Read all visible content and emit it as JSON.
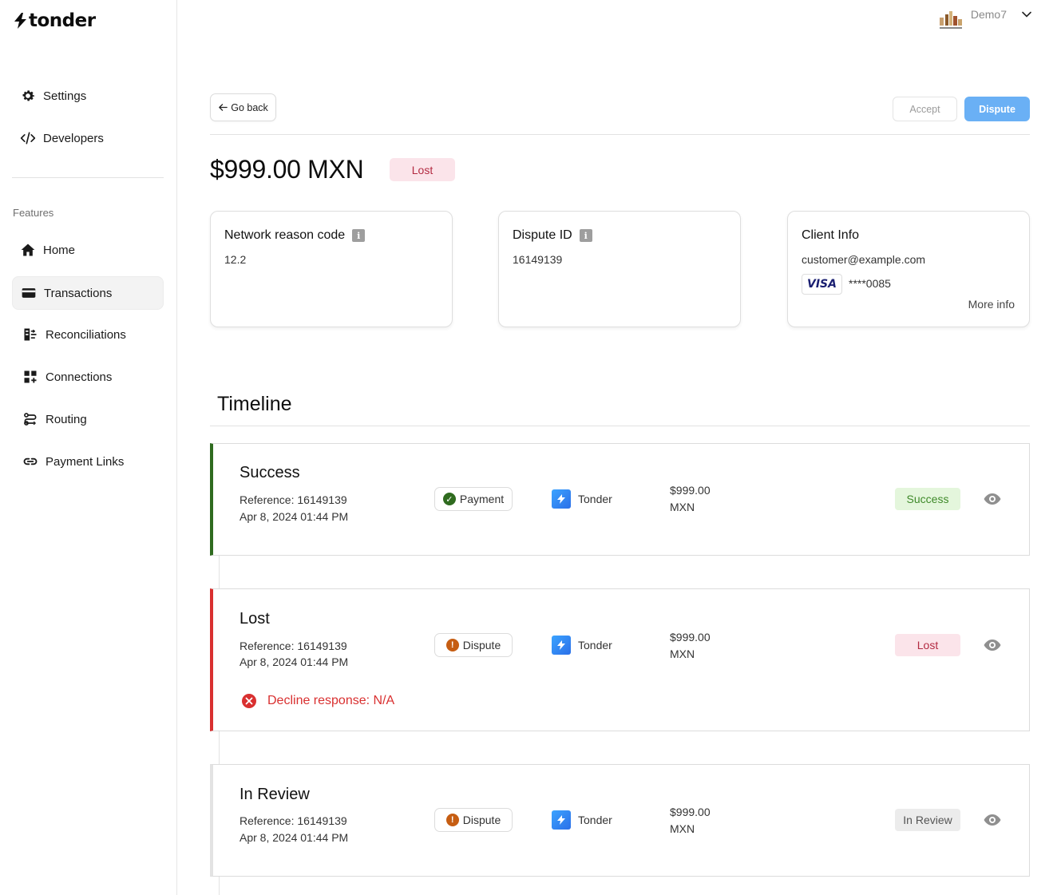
{
  "brand": {
    "name": "tonder"
  },
  "user": {
    "name": "Demo7"
  },
  "sidebar": {
    "top_items": [
      {
        "label": "Settings",
        "icon": "gear-icon"
      },
      {
        "label": "Developers",
        "icon": "code-icon"
      }
    ],
    "section_label": "Features",
    "items": [
      {
        "label": "Home",
        "icon": "home-icon"
      },
      {
        "label": "Transactions",
        "icon": "card-icon",
        "active": true
      },
      {
        "label": "Reconciliations",
        "icon": "reconcile-icon"
      },
      {
        "label": "Connections",
        "icon": "grid-plus-icon"
      },
      {
        "label": "Routing",
        "icon": "route-icon"
      },
      {
        "label": "Payment Links",
        "icon": "link-icon"
      }
    ]
  },
  "header": {
    "back_label": "Go back",
    "accept_label": "Accept",
    "dispute_label": "Dispute"
  },
  "summary": {
    "amount": "$999.00 MXN",
    "status": "Lost"
  },
  "cards": {
    "network": {
      "title": "Network reason code",
      "value": "12.2"
    },
    "dispute": {
      "title": "Dispute ID",
      "value": "16149139"
    },
    "client": {
      "title": "Client Info",
      "email": "customer@example.com",
      "card_brand": "VISA",
      "card_number": "****0085",
      "more_label": "More info"
    }
  },
  "timeline": {
    "title": "Timeline",
    "events": [
      {
        "title": "Success",
        "reference": "Reference: 16149139",
        "date": "Apr 8, 2024 01:44 PM",
        "type": "Payment",
        "provider": "Tonder",
        "amount_value": "$999.00",
        "amount_currency": "MXN",
        "status": "Success",
        "accent": "#2f6b1f"
      },
      {
        "title": "Lost",
        "reference": "Reference: 16149139",
        "date": "Apr 8, 2024 01:44 PM",
        "type": "Dispute",
        "provider": "Tonder",
        "amount_value": "$999.00",
        "amount_currency": "MXN",
        "status": "Lost",
        "decline": "Decline response: N/A",
        "accent": "#d93030"
      },
      {
        "title": "In Review",
        "reference": "Reference: 16149139",
        "date": "Apr 8, 2024 01:44 PM",
        "type": "Dispute",
        "provider": "Tonder",
        "amount_value": "$999.00",
        "amount_currency": "MXN",
        "status": "In Review",
        "accent": "#e3e3e3"
      }
    ]
  },
  "colors": {
    "accent_blue": "#6ab0f5",
    "lost_bg": "#fbe4ea",
    "lost_fg": "#b32b42",
    "success_bg": "#e4f6dc",
    "success_fg": "#3f8a2a",
    "review_bg": "#ececec",
    "review_fg": "#555555"
  }
}
